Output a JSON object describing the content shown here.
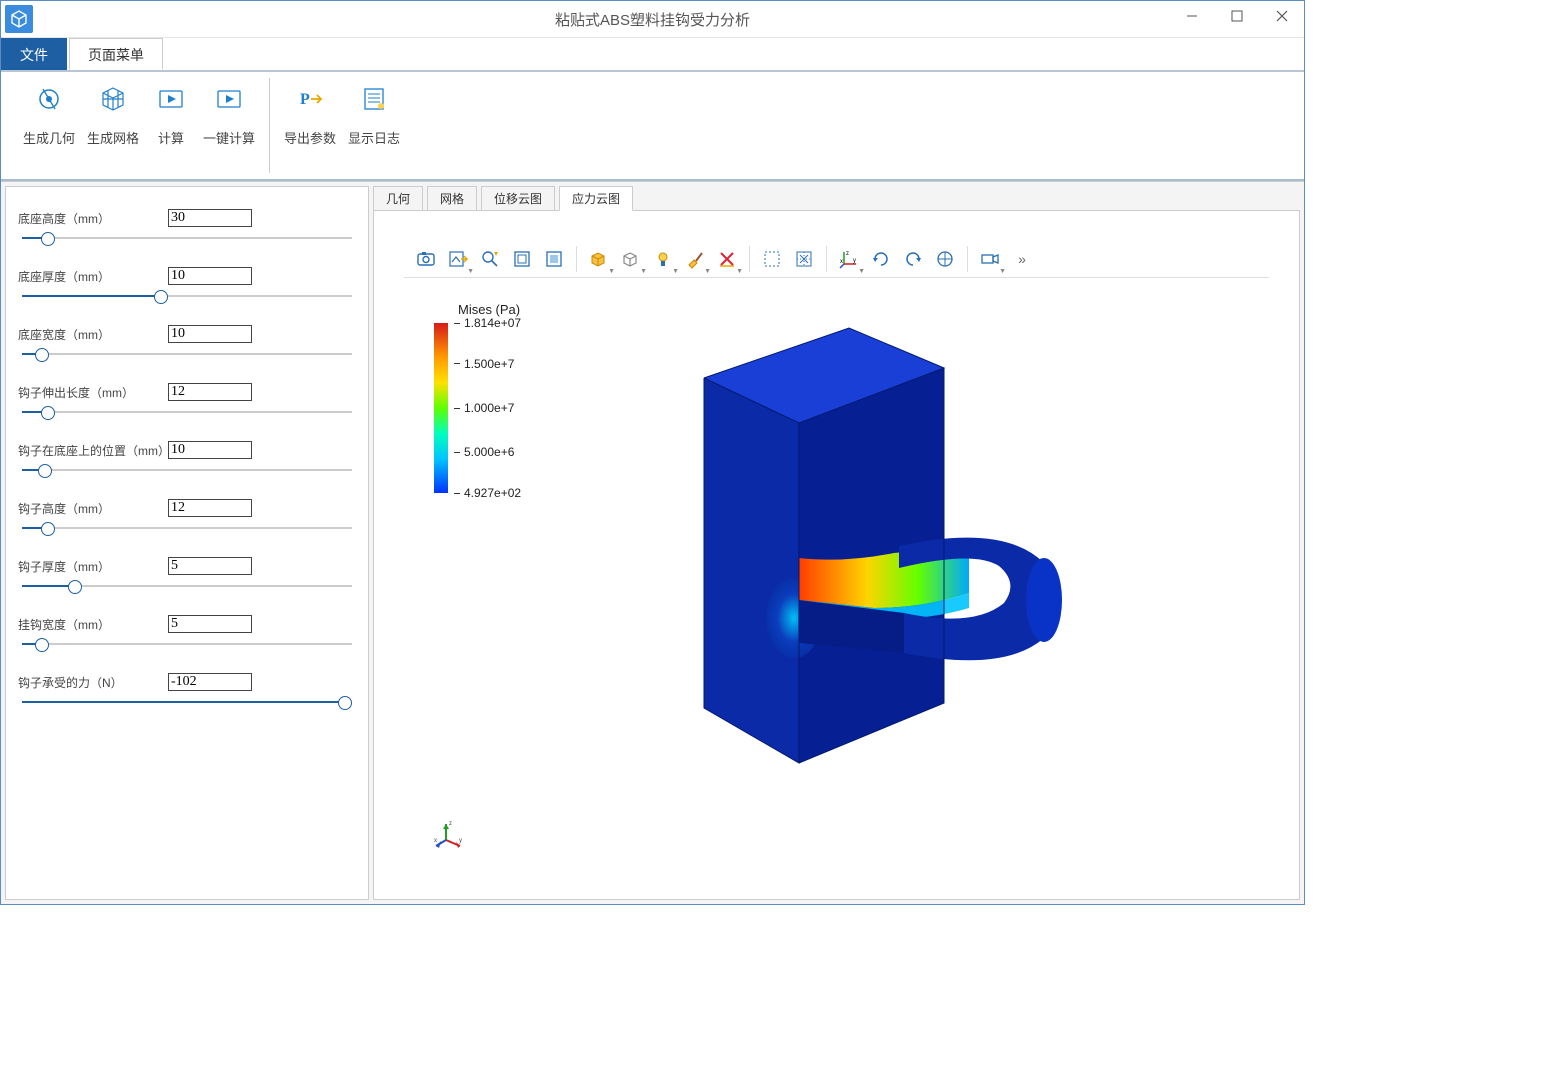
{
  "app": {
    "title": "粘贴式ABS塑料挂钩受力分析"
  },
  "menuTabs": {
    "file": "文件",
    "pageMenu": "页面菜单"
  },
  "ribbon": {
    "genGeom": "生成几何",
    "genMesh": "生成网格",
    "compute": "计算",
    "oneClick": "一键计算",
    "exportParams": "导出参数",
    "showLog": "显示日志"
  },
  "params": [
    {
      "label": "底座高度（mm）",
      "value": "30",
      "pos": 8
    },
    {
      "label": "底座厚度（mm）",
      "value": "10",
      "pos": 42
    },
    {
      "label": "底座宽度（mm）",
      "value": "10",
      "pos": 6
    },
    {
      "label": "钩子伸出长度（mm）",
      "value": "12",
      "pos": 8
    },
    {
      "label": "钩子在底座上的位置（mm）",
      "value": "10",
      "pos": 7
    },
    {
      "label": "钩子高度（mm）",
      "value": "12",
      "pos": 8
    },
    {
      "label": "钩子厚度（mm）",
      "value": "5",
      "pos": 16
    },
    {
      "label": "挂钩宽度（mm）",
      "value": "5",
      "pos": 6
    },
    {
      "label": "钩子承受的力（N）",
      "value": "-102",
      "pos": 98
    }
  ],
  "viewTabs": {
    "geom": "几何",
    "mesh": "网格",
    "disp": "位移云图",
    "stress": "应力云图"
  },
  "legend": {
    "title": "Mises (Pa)",
    "ticks": [
      {
        "label": "1.814e+07",
        "pos": 0
      },
      {
        "label": "1.500e+7",
        "pos": 24
      },
      {
        "label": "1.000e+7",
        "pos": 50
      },
      {
        "label": "5.000e+6",
        "pos": 76
      },
      {
        "label": "4.927e+02",
        "pos": 100
      }
    ]
  },
  "graphicsTools": [
    "screenshot-icon",
    "export-image-icon",
    "zoom-icon",
    "zoom-extents-icon",
    "zoom-box-icon",
    "sep",
    "transparency-icon",
    "wireframe-icon",
    "light-icon",
    "brush-icon",
    "clear-icon",
    "sep",
    "select-box-icon",
    "select-all-icon",
    "sep",
    "axes-icon",
    "rotate-cw-icon",
    "rotate-ccw-icon",
    "view-icon",
    "sep",
    "camera-icon",
    "more-icon"
  ]
}
